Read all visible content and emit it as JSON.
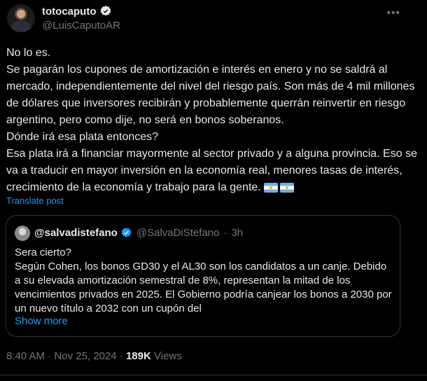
{
  "post": {
    "author": {
      "display_name": "totocaputo",
      "handle": "@LuisCaputoAR"
    },
    "lines": [
      "No lo es.",
      "Se pagarán los cupones de amortización e interés en enero y no se saldrá al mercado, independientemente del nivel del riesgo país. Son más de 4 mil millones de dólares que inversores recibirán y probablemente querrán reinvertir en riesgo argentino, pero como dije, no será en bonos soberanos.",
      "Dónde irá esa plata entonces?",
      "Esa plata irá a financiar mayormente al sector privado y a alguna provincia. Eso se va a traducir en mayor inversión en la economía real, menores tasas de interés, crecimiento de la economía y trabajo para la gente."
    ],
    "translate_label": "Translate post",
    "time": "8:40 AM",
    "date": "Nov 25, 2024",
    "views_count": "189K",
    "views_label": "Views"
  },
  "quote": {
    "display_name": "@salvadistefano",
    "handle": "@SalvaDiStefano",
    "time": "3h",
    "text": "Sera cierto?\nSegún Cohen, los bonos GD30 y el AL30 son los candidatos a un canje. Debido a su elevada amortización semestral de 8%, representan la mitad de los vencimientos privados en 2025. El Gobierno podría canjear los bonos a 2030 por un nuevo título a 2032 con un cupón del",
    "show_more": "Show more"
  },
  "colors": {
    "background": "#000000",
    "text": "#e7e9ea",
    "muted": "#71767b",
    "link": "#1d9bf0",
    "border": "#2f3336"
  }
}
